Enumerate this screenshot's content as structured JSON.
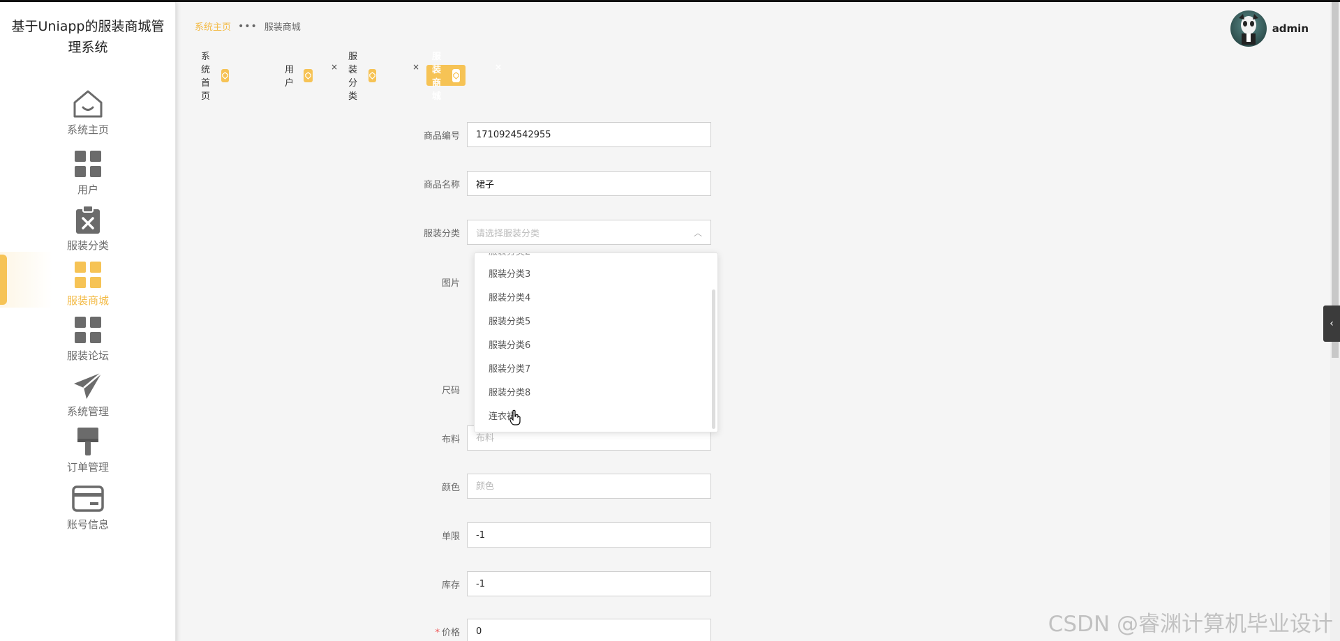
{
  "app": {
    "title": "基于Uniapp的服装商城管理系统"
  },
  "sidebar": {
    "items": [
      {
        "label": "系统主页",
        "icon": "house-icon"
      },
      {
        "label": "用户",
        "icon": "grid-icon"
      },
      {
        "label": "服装分类",
        "icon": "clipboard-x-icon"
      },
      {
        "label": "服装商城",
        "icon": "grid-icon"
      },
      {
        "label": "服装论坛",
        "icon": "grid-icon"
      },
      {
        "label": "系统管理",
        "icon": "paper-plane-icon"
      },
      {
        "label": "订单管理",
        "icon": "brush-icon"
      },
      {
        "label": "账号信息",
        "icon": "card-icon"
      }
    ],
    "active_index": 3
  },
  "breadcrumb": {
    "home": "系统主页",
    "current": "服装商城"
  },
  "user": {
    "name": "admin"
  },
  "tabs": [
    {
      "label": "系统首页",
      "closable": false
    },
    {
      "label": "用户",
      "closable": true
    },
    {
      "label": "服装分类",
      "closable": true
    },
    {
      "label": "服装商城",
      "closable": true,
      "active": true
    }
  ],
  "form": {
    "product_no": {
      "label": "商品编号",
      "value": "1710924542955"
    },
    "product_name": {
      "label": "商品名称",
      "value": "裙子"
    },
    "category": {
      "label": "服装分类",
      "placeholder": "请选择服装分类"
    },
    "image": {
      "label": "图片"
    },
    "size": {
      "label": "尺码"
    },
    "fabric": {
      "label": "布料",
      "placeholder": "布料"
    },
    "color": {
      "label": "颜色",
      "placeholder": "颜色"
    },
    "limit": {
      "label": "单限",
      "value": "-1"
    },
    "stock": {
      "label": "库存",
      "value": "-1"
    },
    "price": {
      "label": "价格",
      "value": "0",
      "required_mark": "*"
    }
  },
  "category_dropdown": {
    "options": [
      "服装分类3",
      "服装分类4",
      "服装分类5",
      "服装分类6",
      "服装分类7",
      "服装分类8",
      "连衣裙"
    ]
  },
  "watermark": {
    "text": "CSDN @睿渊计算机毕业设计"
  },
  "colors": {
    "accent": "#f6c355",
    "accent_text": "#f3bb47"
  }
}
